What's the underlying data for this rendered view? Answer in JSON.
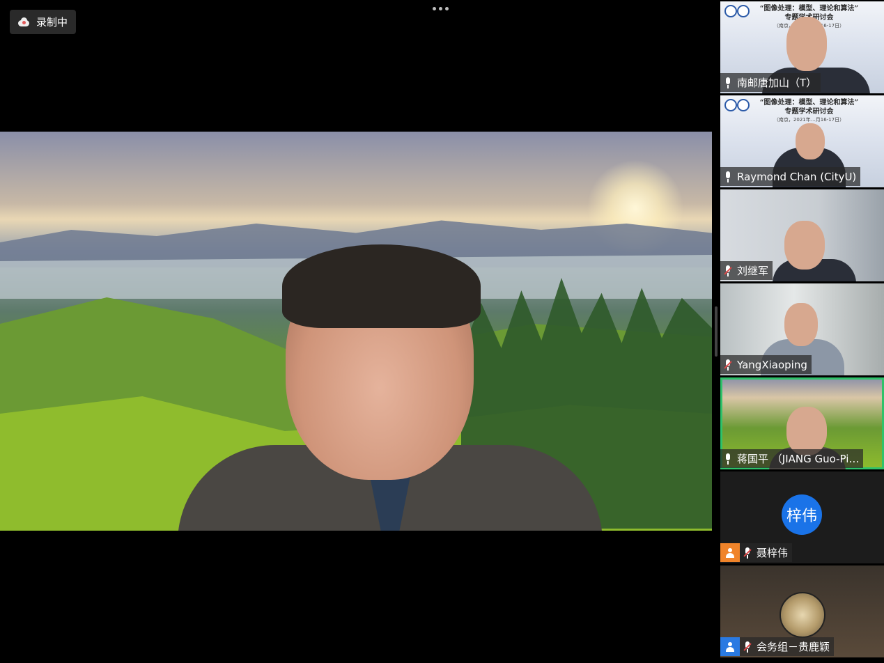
{
  "recording": {
    "label": "录制中"
  },
  "slide": {
    "title_line1": "“图像处理：模型、理论和算法”",
    "title_line2": "专题学术研讨会",
    "subtitle": "（南京，2021年…月16-17日）"
  },
  "participants": [
    {
      "name": "南邮唐加山（T）",
      "mic": "on"
    },
    {
      "name": "Raymond Chan (CityU)",
      "mic": "on"
    },
    {
      "name": "刘继军",
      "mic": "muted"
    },
    {
      "name": "YangXiaoping",
      "mic": "muted"
    },
    {
      "name": "蒋国平 （JIANG Guo-Pi…",
      "mic": "on",
      "active": true
    },
    {
      "name": "聂梓伟",
      "mic": "muted",
      "avatar_text": "梓伟"
    },
    {
      "name": "会务组－贵鹿颖",
      "mic": "muted"
    }
  ],
  "colors": {
    "active_border": "#2ec26a",
    "avatar_blue": "#1a73e8",
    "user_orange": "#f0842a",
    "user_blue": "#2a7ae2"
  }
}
